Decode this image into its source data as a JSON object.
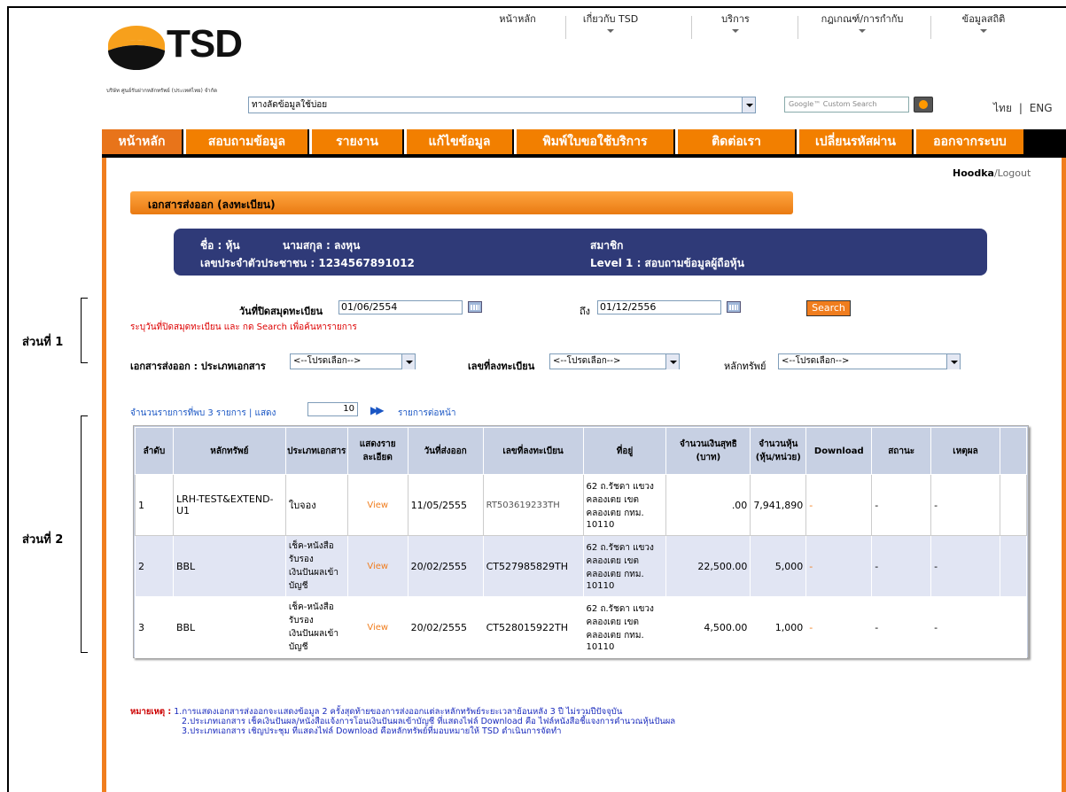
{
  "top_nav": [
    {
      "label": "หน้าหลัก",
      "dropdown": false
    },
    {
      "label": "เกี่ยวกับ TSD",
      "dropdown": true
    },
    {
      "label": "บริการ",
      "dropdown": true
    },
    {
      "label": "กฎเกณฑ์/การกำกับ",
      "dropdown": true
    },
    {
      "label": "ข้อมูลสถิติ",
      "dropdown": true
    }
  ],
  "logo": {
    "text": "TSD",
    "company": "บริษัท ศูนย์รับฝากหลักทรัพย์ (ประเทศไทย) จำกัด"
  },
  "shortcut": {
    "value": "ทางลัดข้อมูลใช้บ่อย"
  },
  "google_search": {
    "placeholder": "Google™ Custom Search"
  },
  "lang": {
    "th": "ไทย",
    "sep": "|",
    "en": "ENG"
  },
  "menu": [
    "หน้าหลัก",
    "สอบถามข้อมูล",
    "รายงาน",
    "แก้ไขข้อมูล",
    "พิมพ์ใบขอใช้บริการ",
    "ติดต่อเรา",
    "เปลี่ยนรหัสผ่าน",
    "ออกจากระบบ"
  ],
  "user": {
    "name": "Hoodka",
    "logout": "/Logout"
  },
  "section_title": "เอกสารส่งออก (ลงทะเบียน)",
  "info": {
    "first_label": "ชื่อ : หุ้น",
    "last_label": "นามสกุล : ลงหุน",
    "id_line": "เลขประจำตัวประชาชน : 1234567891012",
    "member": "สมาชิก",
    "level": "Level 1   :  สอบถามข้อมูลผู้ถือหุ้น"
  },
  "form": {
    "date_label": "วันที่ปิดสมุดทะเบียน",
    "date_from": "01/06/2554",
    "to_label": "ถึง",
    "date_to": "01/12/2556",
    "search": "Search",
    "hint": "ระบุวันที่ปิดสมุดทะเบียน และ กด Search เพื่อค้นหารายการ",
    "doctype_label": "เอกสารส่งออก : ประเภทเอกสาร",
    "doctype_value": "<--โปรดเลือก-->",
    "regno_label": "เลขที่ลงทะเบียน",
    "regno_value": "<--โปรดเลือก-->",
    "security_label": "หลักทรัพย์",
    "security_value": "<--โปรดเลือก-->"
  },
  "side_labels": {
    "part1": "ส่วนที่ 1",
    "part2": "ส่วนที่ 2"
  },
  "paging": {
    "count_text": "จำนวนรายการที่พบ 3 รายการ | แสดง",
    "page_size": "10",
    "next": "รายการต่อหน้า"
  },
  "table": {
    "headers": [
      "ลำดับ",
      "หลักทรัพย์",
      "ประเภทเอกสาร",
      "แสดงรายละเอียด",
      "วันที่ส่งออก",
      "เลขที่ลงทะเบียน",
      "ที่อยู่",
      "จำนวนเงินสุทธิ (บาท)",
      "จำนวนหุ้น (หุ้น/หน่วย)",
      "Download",
      "สถานะ",
      "เหตุผล"
    ],
    "rows": [
      {
        "no": "1",
        "security": "LRH-TEST&EXTEND-U1",
        "doctype": "ใบจอง",
        "view": "View",
        "date": "11/05/2555",
        "regno": "RT503619233TH",
        "address": "62 ถ.รัชดา แขวงคลองเตย เขตคลองเตย กทม. 10110",
        "amount": ".00",
        "shares": "7,941,890",
        "download": "-",
        "status": "-",
        "reason": "-"
      },
      {
        "no": "2",
        "security": "BBL",
        "doctype": "เช็ค-หนังสือรับรองเงินปันผลเข้าบัญชี",
        "view": "View",
        "date": "20/02/2555",
        "regno": "CT527985829TH",
        "address": "62 ถ.รัชดา แขวงคลองเตย เขตคลองเตย กทม. 10110",
        "amount": "22,500.00",
        "shares": "5,000",
        "download": "-",
        "status": "-",
        "reason": "-"
      },
      {
        "no": "3",
        "security": "BBL",
        "doctype": "เช็ค-หนังสือรับรองเงินปันผลเข้าบัญชี",
        "view": "View",
        "date": "20/02/2555",
        "regno": "CT528015922TH",
        "address": "62 ถ.รัชดา แขวงคลองเตย เขตคลองเตย กทม. 10110",
        "amount": "4,500.00",
        "shares": "1,000",
        "download": "-",
        "status": "-",
        "reason": "-"
      }
    ]
  },
  "notes": {
    "label": "หมายเหตุ :",
    "n1": "1.การแสดงเอกสารส่งออกจะแสดงข้อมูล 2 ครั้งสุดท้ายของการส่งออกแต่ละหลักทรัพย์ระยะเวลาย้อนหลัง 3 ปี ไม่รวมปีปัจจุบัน",
    "n2": "2.ประเภทเอกสาร เช็คเงินปันผล/หนังสือแจ้งการโอนเงินปันผลเข้าบัญชี ที่แสดงไฟล์ Download คือ ไฟล์หนังสือชี้แจงการคำนวณหุ้นปันผล",
    "n3": "3.ประเภทเอกสาร เชิญประชุม ที่แสดงไฟล์ Download คือหลักทรัพย์ที่มอบหมายให้ TSD ดำเนินการจัดทำ"
  },
  "colors": {
    "orange": "#f07d1e",
    "navy": "#2f3a78",
    "table_header": "#c7d0e3",
    "row_alt": "#e1e5f3"
  }
}
